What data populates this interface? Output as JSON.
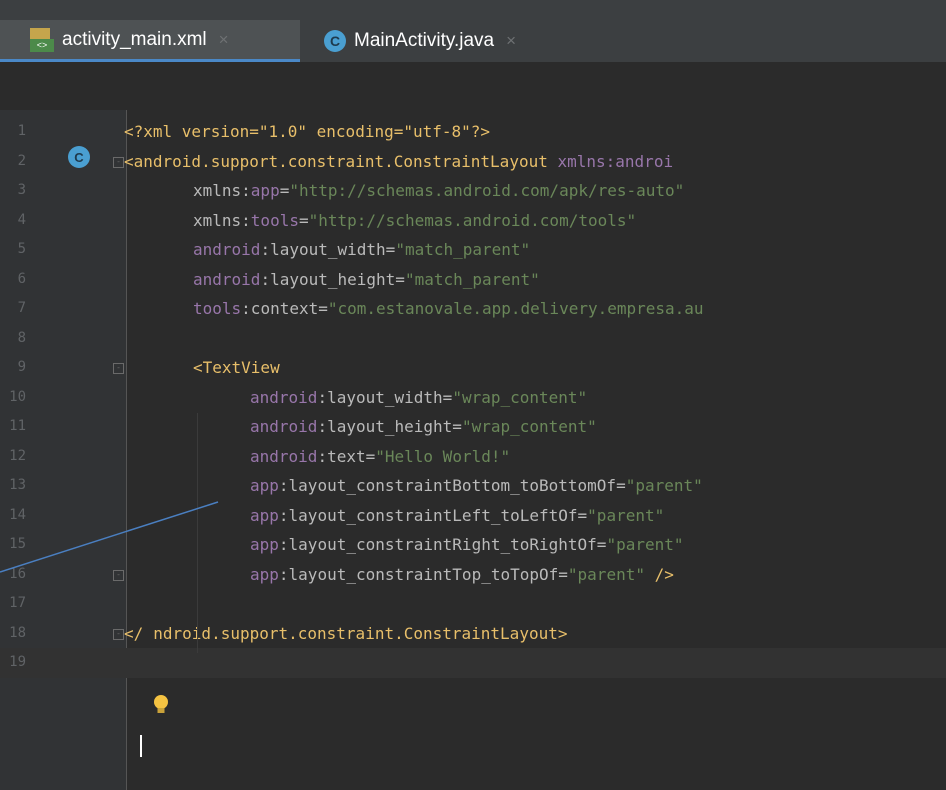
{
  "tabs": [
    {
      "label": "activity_main.xml",
      "close": "×"
    },
    {
      "label": "MainActivity.java",
      "close": "×",
      "icon_letter": "C"
    }
  ],
  "gutter": {
    "line_numbers": [
      "1",
      "2",
      "3",
      "4",
      "5",
      "6",
      "7",
      "8",
      "9",
      "10",
      "11",
      "12",
      "13",
      "14",
      "15",
      "16",
      "17",
      "18",
      "19"
    ],
    "class_marker_letter": "C"
  },
  "code": {
    "l1": {
      "text": "<?xml version=\"1.0\" encoding=\"utf-8\"?>"
    },
    "l2": {
      "tag": "<android.support.constraint.ConstraintLayout ",
      "ns": "xmlns:",
      "attr": "androi"
    },
    "l3": {
      "ns": "xmlns:",
      "attr": "app",
      "eq": "=",
      "val": "\"http://schemas.android.com/apk/res-auto\""
    },
    "l4": {
      "ns": "xmlns:",
      "attr": "tools",
      "eq": "=",
      "val": "\"http://schemas.android.com/tools\""
    },
    "l5": {
      "ns": "android",
      "attr": ":layout_width",
      "eq": "=",
      "val": "\"match_parent\""
    },
    "l6": {
      "ns": "android",
      "attr": ":layout_height",
      "eq": "=",
      "val": "\"match_parent\""
    },
    "l7": {
      "ns": "tools",
      "attr": ":context",
      "eq": "=",
      "val": "\"com.estanovale.app.delivery.empresa.au"
    },
    "l9": {
      "tag": "<TextView"
    },
    "l10": {
      "ns": "android",
      "attr": ":layout_width",
      "eq": "=",
      "val": "\"wrap_content\""
    },
    "l11": {
      "ns": "android",
      "attr": ":layout_height",
      "eq": "=",
      "val": "\"wrap_content\""
    },
    "l12": {
      "ns": "android",
      "attr": ":text",
      "eq": "=",
      "val": "\"Hello World!\""
    },
    "l13": {
      "ns": "app",
      "attr": ":layout_constraintBottom_toBottomOf",
      "eq": "=",
      "val": "\"parent\""
    },
    "l14": {
      "ns": "app",
      "attr": ":layout_constraintLeft_toLeftOf",
      "eq": "=",
      "val": "\"parent\""
    },
    "l15": {
      "ns": "app",
      "attr": ":layout_constraintRight_toRightOf",
      "eq": "=",
      "val": "\"parent\""
    },
    "l16": {
      "ns": "app",
      "attr": ":layout_constraintTop_toTopOf",
      "eq": "=",
      "val": "\"parent\"",
      "end": " />"
    },
    "l18": {
      "open": "</",
      "text": "ndroid.support.constraint.ConstraintLayout>"
    }
  },
  "colors": {
    "background": "#2b2b2b",
    "tag": "#e8bf6a",
    "namespace": "#9876aa",
    "value": "#6a8759",
    "tab_underline": "#4a88c7"
  }
}
